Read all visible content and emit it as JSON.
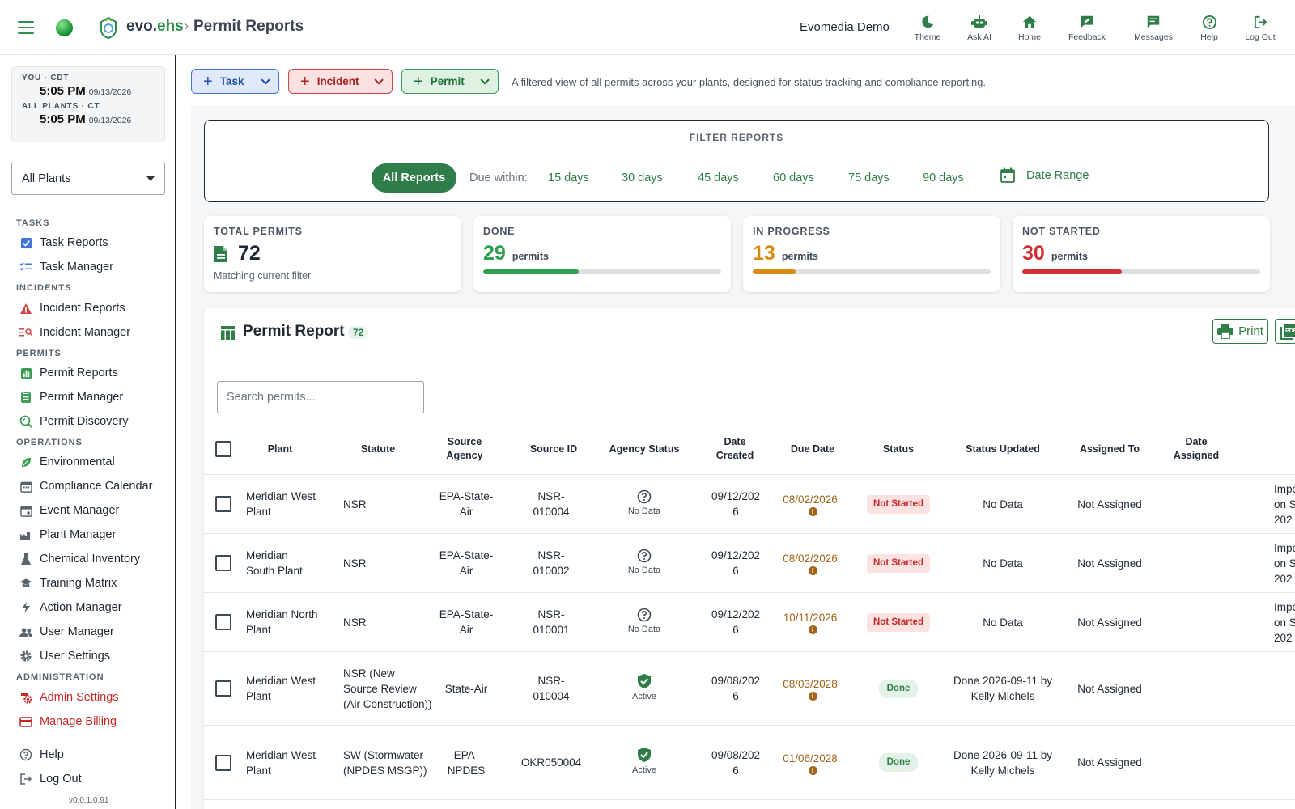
{
  "header": {
    "brand_main": "evo.",
    "brand_accent": "ehs",
    "separator": "›",
    "page_title": "Permit Reports",
    "org_name": "Evomedia Demo",
    "actions": [
      {
        "label": "Theme",
        "icon": "moon-icon"
      },
      {
        "label": "Ask AI",
        "icon": "robot-icon"
      },
      {
        "label": "Home",
        "icon": "home-icon"
      },
      {
        "label": "Feedback",
        "icon": "feedback-icon"
      },
      {
        "label": "Messages",
        "icon": "messages-icon"
      },
      {
        "label": "Help",
        "icon": "help-icon"
      },
      {
        "label": "Log Out",
        "icon": "logout-icon"
      }
    ]
  },
  "sidebar": {
    "clock": {
      "you_label": "YOU · CDT",
      "you_time": "5:05 PM",
      "you_date": "09/13/2026",
      "plants_label": "ALL PLANTS · CT",
      "plants_time": "5:05 PM",
      "plants_date": "09/13/2026"
    },
    "plant_select": "All Plants",
    "sections": {
      "tasks": "TASKS",
      "incidents": "INCIDENTS",
      "permits": "PERMITS",
      "operations": "OPERATIONS",
      "administration": "ADMINISTRATION"
    },
    "items": {
      "task_reports": "Task Reports",
      "task_manager": "Task Manager",
      "incident_reports": "Incident Reports",
      "incident_manager": "Incident Manager",
      "permit_reports": "Permit Reports",
      "permit_manager": "Permit Manager",
      "permit_discovery": "Permit Discovery",
      "environmental": "Environmental",
      "compliance_calendar": "Compliance Calendar",
      "event_manager": "Event Manager",
      "plant_manager": "Plant Manager",
      "chemical_inventory": "Chemical Inventory",
      "training_matrix": "Training Matrix",
      "action_manager": "Action Manager",
      "user_manager": "User Manager",
      "user_settings": "User Settings",
      "admin_settings": "Admin Settings",
      "manage_billing": "Manage Billing",
      "help": "Help",
      "log_out": "Log Out"
    },
    "version": "v0.0.1.0.91"
  },
  "quick_actions": {
    "task": "Task",
    "incident": "Incident",
    "permit": "Permit",
    "intro": "A filtered view of all permits across your plants, designed for status tracking and compliance reporting."
  },
  "filters": {
    "title": "FILTER REPORTS",
    "all_reports": "All Reports",
    "due_within": "Due within:",
    "ranges": [
      "15 days",
      "30 days",
      "45 days",
      "60 days",
      "75 days",
      "90 days"
    ],
    "date_range": "Date Range"
  },
  "stats": {
    "total": {
      "label": "TOTAL PERMITS",
      "value": "72",
      "sub": "Matching current filter"
    },
    "done": {
      "label": "DONE",
      "value": "29",
      "unit": "permits",
      "fraction": 0.403,
      "color": "#2e9e4f"
    },
    "in_progress": {
      "label": "IN PROGRESS",
      "value": "13",
      "unit": "permits",
      "fraction": 0.181,
      "color": "#d98a12"
    },
    "not_started": {
      "label": "NOT STARTED",
      "value": "30",
      "unit": "permits",
      "fraction": 0.417,
      "color": "#d32f2f"
    }
  },
  "report": {
    "title": "Permit Report",
    "count": "72",
    "print": "Print",
    "search_placeholder": "Search permits...",
    "columns": [
      "Plant",
      "Statute",
      "Source Agency",
      "Source ID",
      "Agency Status",
      "Date Created",
      "Due Date",
      "Status",
      "Status Updated",
      "Assigned To",
      "Date Assigned"
    ],
    "rows": [
      {
        "plant": "Meridian West Plant",
        "statute": "NSR",
        "agency": "EPA-State-Air",
        "source_id": "NSR-010004",
        "agency_status": "No Data",
        "created": "09/12/2026",
        "due": "08/02/2026",
        "status": "Not Started",
        "updated": "No Data",
        "assigned": "Not Assigned",
        "extra": "Impo|on S|202"
      },
      {
        "plant": "Meridian South Plant",
        "statute": "NSR",
        "agency": "EPA-State-Air",
        "source_id": "NSR-010002",
        "agency_status": "No Data",
        "created": "09/12/2026",
        "due": "08/02/2026",
        "status": "Not Started",
        "updated": "No Data",
        "assigned": "Not Assigned",
        "extra": "Impo|on S|202"
      },
      {
        "plant": "Meridian North Plant",
        "statute": "NSR",
        "agency": "EPA-State-Air",
        "source_id": "NSR-010001",
        "agency_status": "No Data",
        "created": "09/12/2026",
        "due": "10/11/2026",
        "status": "Not Started",
        "updated": "No Data",
        "assigned": "Not Assigned",
        "extra": "Impo|on S|202"
      },
      {
        "plant": "Meridian West Plant",
        "statute": "NSR (New Source Review (Air Construction))",
        "agency": "State-Air",
        "source_id": "NSR-010004",
        "agency_status": "Active",
        "created": "09/08/2026",
        "due": "08/03/2028",
        "status": "Done",
        "updated": "Done 2026-09-11 by Kelly Michels",
        "assigned": "Not Assigned",
        "extra": ""
      },
      {
        "plant": "Meridian West Plant",
        "statute": "SW (Stormwater (NPDES MSGP))",
        "agency": "EPA-NPDES",
        "source_id": "OKR050004",
        "agency_status": "Active",
        "created": "09/08/2026",
        "due": "01/06/2028",
        "status": "Done",
        "updated": "Done 2026-09-11 by Kelly Michels",
        "assigned": "Not Assigned",
        "extra": ""
      }
    ]
  }
}
